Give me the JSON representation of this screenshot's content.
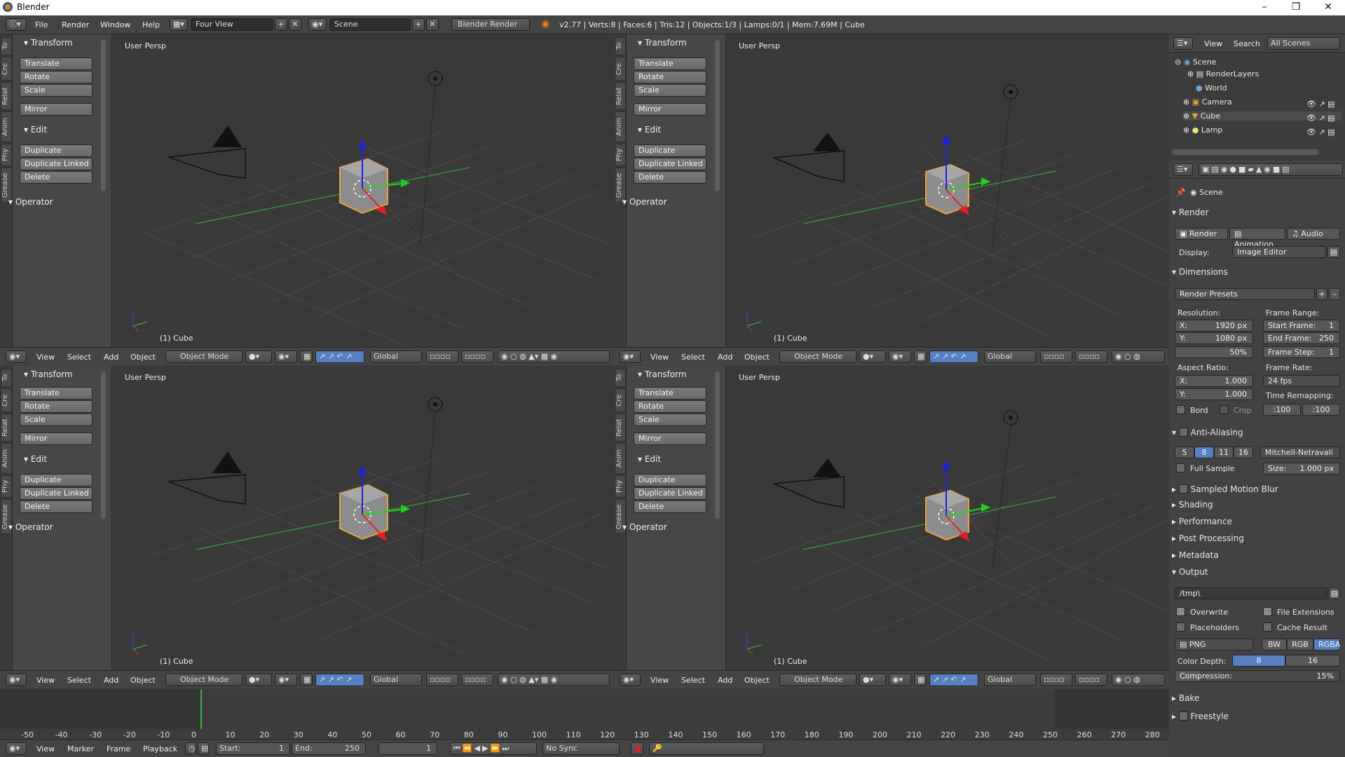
{
  "title": "Blender",
  "menu": [
    "File",
    "Render",
    "Window",
    "Help"
  ],
  "layout": "Four View",
  "scene": "Scene",
  "engine": "Blender Render",
  "info": "v2.77 | Verts:8 | Faces:6 | Tris:12 | Objects:1/3 | Lamps:0/1 | Mem:7.69M | Cube",
  "tool_tabs": [
    "To",
    "Cre",
    "Relat",
    "Anim",
    "Phy",
    "Grease"
  ],
  "transform_header": "Transform",
  "edit_header": "Edit",
  "operator_header": "Operator",
  "tools": {
    "translate": "Translate",
    "rotate": "Rotate",
    "scale": "Scale",
    "mirror": "Mirror",
    "duplicate": "Duplicate",
    "duplicate_linked": "Duplicate Linked",
    "delete": "Delete"
  },
  "viewport": {
    "label": "User Persp",
    "object": "(1) Cube"
  },
  "vhdr": {
    "view": "View",
    "select": "Select",
    "add": "Add",
    "object": "Object",
    "mode": "Object Mode",
    "orientation": "Global"
  },
  "outliner": {
    "view": "View",
    "search": "Search",
    "filter": "All Scenes",
    "items": [
      "Scene",
      "RenderLayers",
      "World",
      "Camera",
      "Cube",
      "Lamp"
    ]
  },
  "props": {
    "scene_label": "Scene",
    "render": "Render",
    "render_btns": [
      "Render",
      "Animation",
      "Audio"
    ],
    "display_label": "Display:",
    "display_value": "Image Editor",
    "dimensions": "Dimensions",
    "render_presets": "Render Presets",
    "resolution": "Resolution:",
    "res_x": "X:",
    "res_x_val": "1920 px",
    "res_y": "Y:",
    "res_y_val": "1080 px",
    "res_pct": "50%",
    "frame_range": "Frame Range:",
    "start_frame": "Start Frame:",
    "start_val": "1",
    "end_frame": "End Frame:",
    "end_val": "250",
    "frame_step": "Frame Step:",
    "step_val": "1",
    "aspect": "Aspect Ratio:",
    "asp_x_val": "1.000",
    "asp_y_val": "1.000",
    "frame_rate": "Frame Rate:",
    "fps": "24 fps",
    "time_remap": "Time Remapping:",
    "remap_old": ":100",
    "remap_new": ":100",
    "bord": "Bord",
    "crop": "Crop",
    "aa": "Anti-Aliasing",
    "aa_samples": [
      "5",
      "8",
      "11",
      "16"
    ],
    "aa_filter": "Mitchell-Netravali",
    "full_sample": "Full Sample",
    "size": "Size:",
    "size_val": "1.000 px",
    "sections": [
      "Sampled Motion Blur",
      "Shading",
      "Performance",
      "Post Processing",
      "Metadata"
    ],
    "output": "Output",
    "out_path": "/tmp\\",
    "overwrite": "Overwrite",
    "file_ext": "File Extensions",
    "placeholders": "Placeholders",
    "cache_result": "Cache Result",
    "format": "PNG",
    "color_modes": [
      "BW",
      "RGB",
      "RGBA"
    ],
    "color_depth": "Color Depth:",
    "depths": [
      "8",
      "16"
    ],
    "compression": "Compression:",
    "compression_val": "15%",
    "bake": "Bake",
    "freestyle": "Freestyle"
  },
  "timeline": {
    "ticks": [
      "-50",
      "-40",
      "-30",
      "-20",
      "-10",
      "0",
      "10",
      "20",
      "30",
      "40",
      "50",
      "60",
      "70",
      "80",
      "90",
      "100",
      "110",
      "120",
      "130",
      "140",
      "150",
      "160",
      "170",
      "180",
      "190",
      "200",
      "210",
      "220",
      "230",
      "240",
      "250",
      "260",
      "270",
      "280"
    ],
    "menu": [
      "View",
      "Marker",
      "Frame",
      "Playback"
    ],
    "start_label": "Start:",
    "start": "1",
    "end_label": "End:",
    "end": "250",
    "current": "1",
    "sync": "No Sync"
  },
  "colors": {
    "accent": "#5680c2",
    "active": "#e87d0d"
  }
}
